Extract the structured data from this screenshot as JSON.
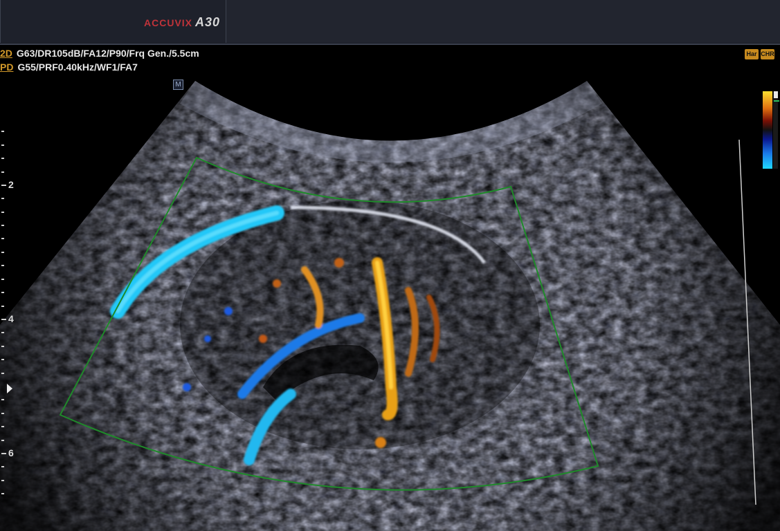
{
  "brand": {
    "name": "ACCUVIX",
    "model": "A30"
  },
  "params": {
    "line1_mode": "2D",
    "line1_text": "G63/DR105dB/FA12/P90/Frq Gen./5.5cm",
    "line2_mode": "PD",
    "line2_text": "G55/PRF0.40kHz/WF1/FA7"
  },
  "badges": {
    "har": "Har",
    "chr": "CHR"
  },
  "marker": {
    "m": "M"
  },
  "depth_scale": {
    "labels": [
      "2",
      "4",
      "6"
    ]
  },
  "colors": {
    "doppler_hot": "#f0b020",
    "doppler_blue": "#1a60e0",
    "doppler_cyan": "#20c8f8",
    "roi_box": "#1f8a2a"
  },
  "icons": [
    "focus-arrow-icon"
  ]
}
